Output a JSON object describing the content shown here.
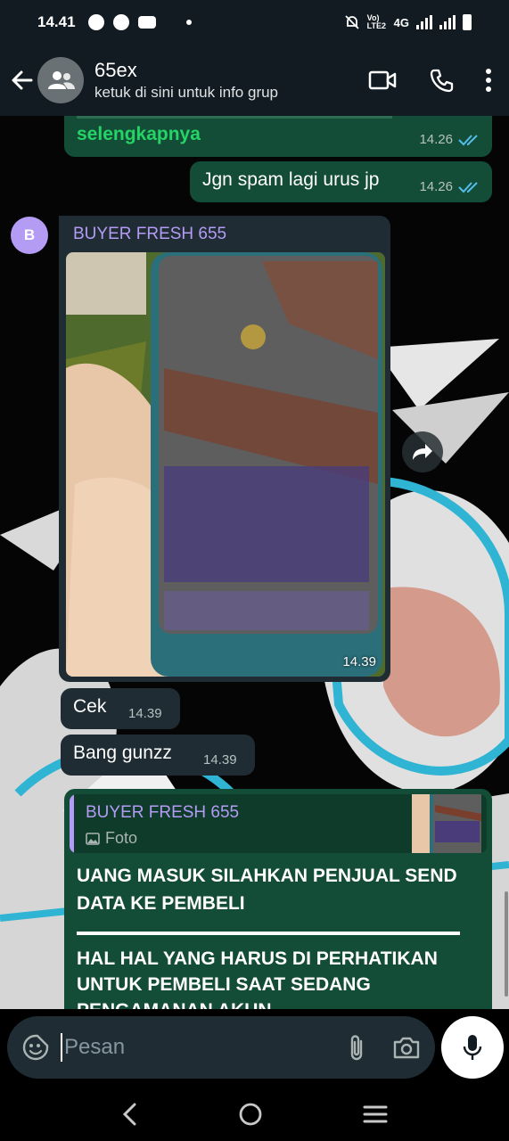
{
  "status_bar": {
    "time": "14.41",
    "network": "4G",
    "volte": "Vo) LTE2",
    "icons": [
      "facebook-icon",
      "messenger-icon",
      "youtube-icon",
      "notification-dot",
      "mute-icon",
      "signal-icon",
      "battery-icon"
    ]
  },
  "header": {
    "title": "65ex",
    "subtitle": "ketuk di sini untuk info grup",
    "actions": [
      "video-call-icon",
      "voice-call-icon",
      "more-options-icon"
    ]
  },
  "messages": {
    "m1": {
      "text": "selengkapnya",
      "time": "14.26",
      "status": "read"
    },
    "m2": {
      "text": "Jgn spam lagi urus jp",
      "time": "14.26",
      "status": "read"
    },
    "m3": {
      "avatar_letter": "B",
      "sender": "BUYER FRESH 655",
      "type": "photo",
      "time": "14.39"
    },
    "m4": {
      "text": "Cek",
      "time": "14.39"
    },
    "m5": {
      "text": "Bang gunzz",
      "time": "14.39"
    },
    "m6": {
      "quote_sender": "BUYER FRESH 655",
      "quote_type": "Foto",
      "text1": "UANG MASUK SILAHKAN PENJUAL SEND DATA KE PEMBELI",
      "text2": "HAL HAL YANG HARUS DI PERHATIKAN UNTUK PEMBELI SAAT SEDANG PENGAMANAN AKUN"
    }
  },
  "composer": {
    "placeholder": "Pesan",
    "value": ""
  },
  "colors": {
    "header_bg": "#111b21",
    "outgoing_bubble": "#144d37",
    "incoming_bubble": "#1f2c33",
    "link_green": "#25d366",
    "sender_purple": "#b49cf5",
    "read_tick": "#53bdeb"
  }
}
